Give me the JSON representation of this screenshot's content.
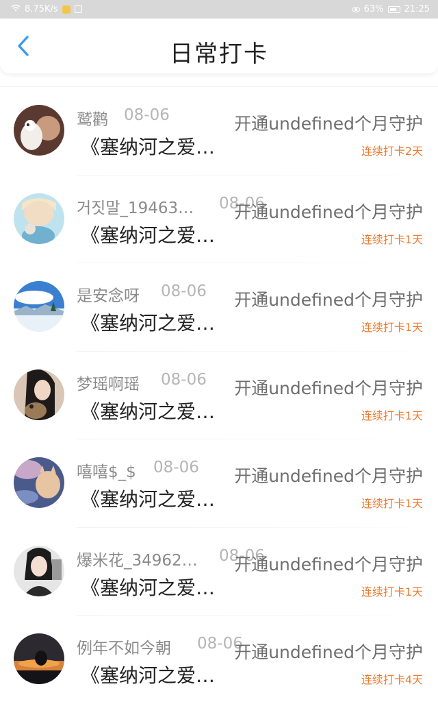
{
  "status_bar": {
    "speed": "8.75K/s",
    "battery_percent": "63%",
    "time": "21:25"
  },
  "header": {
    "title": "日常打卡"
  },
  "colors": {
    "accent_blue": "#3a9bf0",
    "streak_orange": "#ee7a2f"
  },
  "checkins": [
    {
      "name": "鹫鹳",
      "date": "08-06",
      "title": "《塞纳河之爱…",
      "guard": "开通undefined个月守护",
      "streak": "连续打卡2天"
    },
    {
      "name": "거짓말_19463…",
      "date": "08-06",
      "title": "《塞纳河之爱…",
      "guard": "开通undefined个月守护",
      "streak": "连续打卡1天"
    },
    {
      "name": "是安念呀",
      "date": "08-06",
      "title": "《塞纳河之爱…",
      "guard": "开通undefined个月守护",
      "streak": "连续打卡1天"
    },
    {
      "name": "梦瑶啊瑶",
      "date": "08-06",
      "title": "《塞纳河之爱…",
      "guard": "开通undefined个月守护",
      "streak": "连续打卡1天"
    },
    {
      "name": "嘻嘻$_$",
      "date": "08-06",
      "title": "《塞纳河之爱…",
      "guard": "开通undefined个月守护",
      "streak": "连续打卡1天"
    },
    {
      "name": "爆米花_34962…",
      "date": "08-06",
      "title": "《塞纳河之爱…",
      "guard": "开通undefined个月守护",
      "streak": "连续打卡1天"
    },
    {
      "name": "例年不如今朝",
      "date": "08-06",
      "title": "《塞纳河之爱…",
      "guard": "开通undefined个月守护",
      "streak": "连续打卡4天"
    }
  ]
}
